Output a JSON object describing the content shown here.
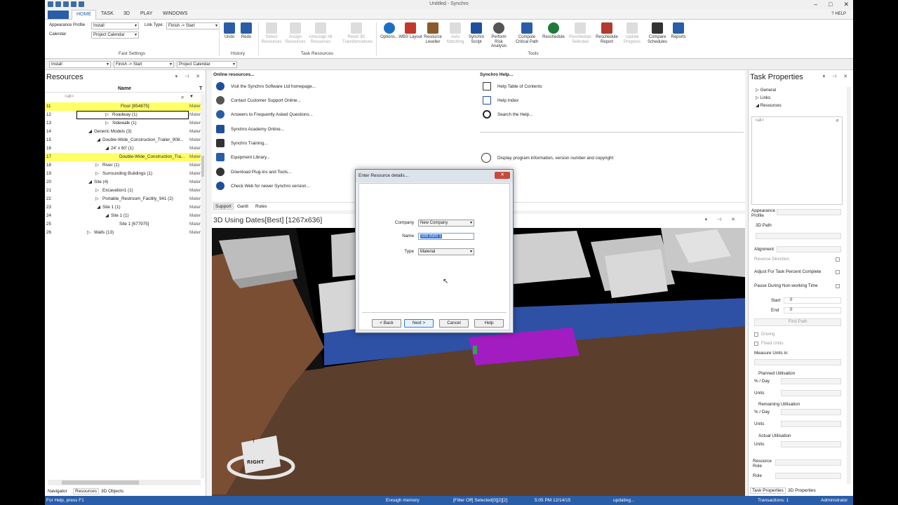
{
  "app": {
    "title": "Untitled - Synchro",
    "help_label": "HELP"
  },
  "ribbon_tabs": [
    "HOME",
    "TASK",
    "3D",
    "PLAY",
    "WINDOWS"
  ],
  "fast_settings": {
    "appearance_label": "Appearance Profile",
    "appearance_value": "Install",
    "link_type_label": "Link Type:",
    "link_type_value": "Finish -> Start",
    "calendar_label": "Calendar",
    "calendar_value": "Project Calendar",
    "group_label": "Fast Settings"
  },
  "history": {
    "undo": "Undo",
    "redo": "Redo",
    "group_label": "History"
  },
  "task_resources": {
    "select": "Select Resources",
    "assign": "Assign Resources",
    "unassign": "Unassign All Resources",
    "reset": "Reset 3D Transformations",
    "group_label": "Task Resources"
  },
  "tools": {
    "options": "Options...",
    "wbs": "WBS Layout",
    "leveller": "Resource Leveller",
    "auto": "Auto Matching",
    "script": "Synchro Script",
    "risk": "Perform Risk Analysis",
    "critical": "Compute Critical Path",
    "reschedule": "Reschedule",
    "resched_sel": "Reschedule Selected",
    "resched_report": "Reschedule Report",
    "update": "Update Progress",
    "compare": "Compare Schedules",
    "reports": "Reports",
    "group_label": "Tools"
  },
  "subbar": {
    "profile": "Install",
    "link": "Finish -> Start",
    "calendar": "Project Calendar"
  },
  "resources": {
    "title": "Resources",
    "col_name": "Name",
    "col_type": "T",
    "filter": "<all>",
    "rows": [
      {
        "num": "11",
        "name": "Floor [854875]",
        "type": "Materi"
      },
      {
        "num": "12",
        "name": "Roadway (1)",
        "type": "Materi"
      },
      {
        "num": "13",
        "name": "Sidewalk (1)",
        "type": "Materi"
      },
      {
        "num": "14",
        "name": "Generic Models (3)",
        "type": "Materi"
      },
      {
        "num": "15",
        "name": "Double-Wide_Construction_Trailer_908...",
        "type": "Materi"
      },
      {
        "num": "16",
        "name": "24' x 60' (1)",
        "type": "Materi"
      },
      {
        "num": "17",
        "name": "Double-Wide_Construction_Tra...",
        "type": "Materi"
      },
      {
        "num": "18",
        "name": "River (1)",
        "type": "Materi"
      },
      {
        "num": "19",
        "name": "Surrounding Buildings (1)",
        "type": "Materi"
      },
      {
        "num": "20",
        "name": "Site (4)",
        "type": "Materi"
      },
      {
        "num": "21",
        "name": "Excavation1 (1)",
        "type": "Materi"
      },
      {
        "num": "22",
        "name": "Portable_Restroom_Facility_941 (2)",
        "type": "Materi"
      },
      {
        "num": "23",
        "name": "Site 1 (1)",
        "type": "Materi"
      },
      {
        "num": "24",
        "name": "Site 1 (1)",
        "type": "Materi"
      },
      {
        "num": "25",
        "name": "Site 1 [677975]",
        "type": "Materi"
      },
      {
        "num": "26",
        "name": "Walls (13)",
        "type": "Materi"
      }
    ],
    "tabs": [
      "Navigator",
      "Resources",
      "3D Objects"
    ]
  },
  "support": {
    "online_header": "Online resources...",
    "help_header": "Synchro Help...",
    "online_links": [
      "Visit the Synchro Software Ltd homepage...",
      "Contact Customer Support Online...",
      "Answers to Frequently Asked Questions...",
      "Synchro Academy Online...",
      "Synchro Training...",
      "Equipment Library...",
      "Download Plug-ins and Tools...",
      "Check Web for newer Synchro version..."
    ],
    "help_links": [
      "Help Table of Contents",
      "Help Index",
      "Search the Help..."
    ],
    "about": "Display program information, version number and copyright",
    "tabs": [
      "Support",
      "Gantt",
      "Rules"
    ]
  },
  "view3d": {
    "title": "3D Using Dates[Best] [1267x636]",
    "cube_top": "↑",
    "cube_label": "RIGHT"
  },
  "dialog": {
    "title": "Enter Resource details...",
    "company_label": "Company",
    "company_value": "New Company",
    "name_label": "Name",
    "name_value": "Site dwfx 1",
    "type_label": "Type",
    "type_value": "Material",
    "back": "< Back",
    "next": "Next >",
    "cancel": "Cancel",
    "help": "Help"
  },
  "task_properties": {
    "title": "Task Properties",
    "tree": [
      "General",
      "Links",
      "Resources"
    ],
    "filter": "<all>",
    "appearance_profile": "Appearance Profile",
    "path3d": "3D Path",
    "alignment": "Alignment",
    "reverse": "Reverse Direction",
    "adjust": "Adjust For Task Percent Complete",
    "pause": "Pause During Non-working Time",
    "start_label": "Start",
    "start_value": "0",
    "end_label": "End",
    "end_value": "0",
    "find_path": "Find Path",
    "driving": "Driving",
    "fixed_units": "Fixed Units",
    "measure_units": "Measure Units in:",
    "planned": "Planned Utilisation",
    "pct_day": "% / Day",
    "units": "Units",
    "remaining": "Remaining Utilisation",
    "actual": "Actual Utilisation",
    "resource_role": "Resource Role",
    "role": "Role",
    "tabs": [
      "Task Properties",
      "3D Properties"
    ]
  },
  "status": {
    "left": "For Help, press F1",
    "memory": "Enough memory",
    "filter": "[Filter Off]  Selected[0][2][2]",
    "datetime": "5:05 PM 12/14/15",
    "updating": "updating...",
    "transactions": "Transactions: 1",
    "user": "Administrator"
  }
}
